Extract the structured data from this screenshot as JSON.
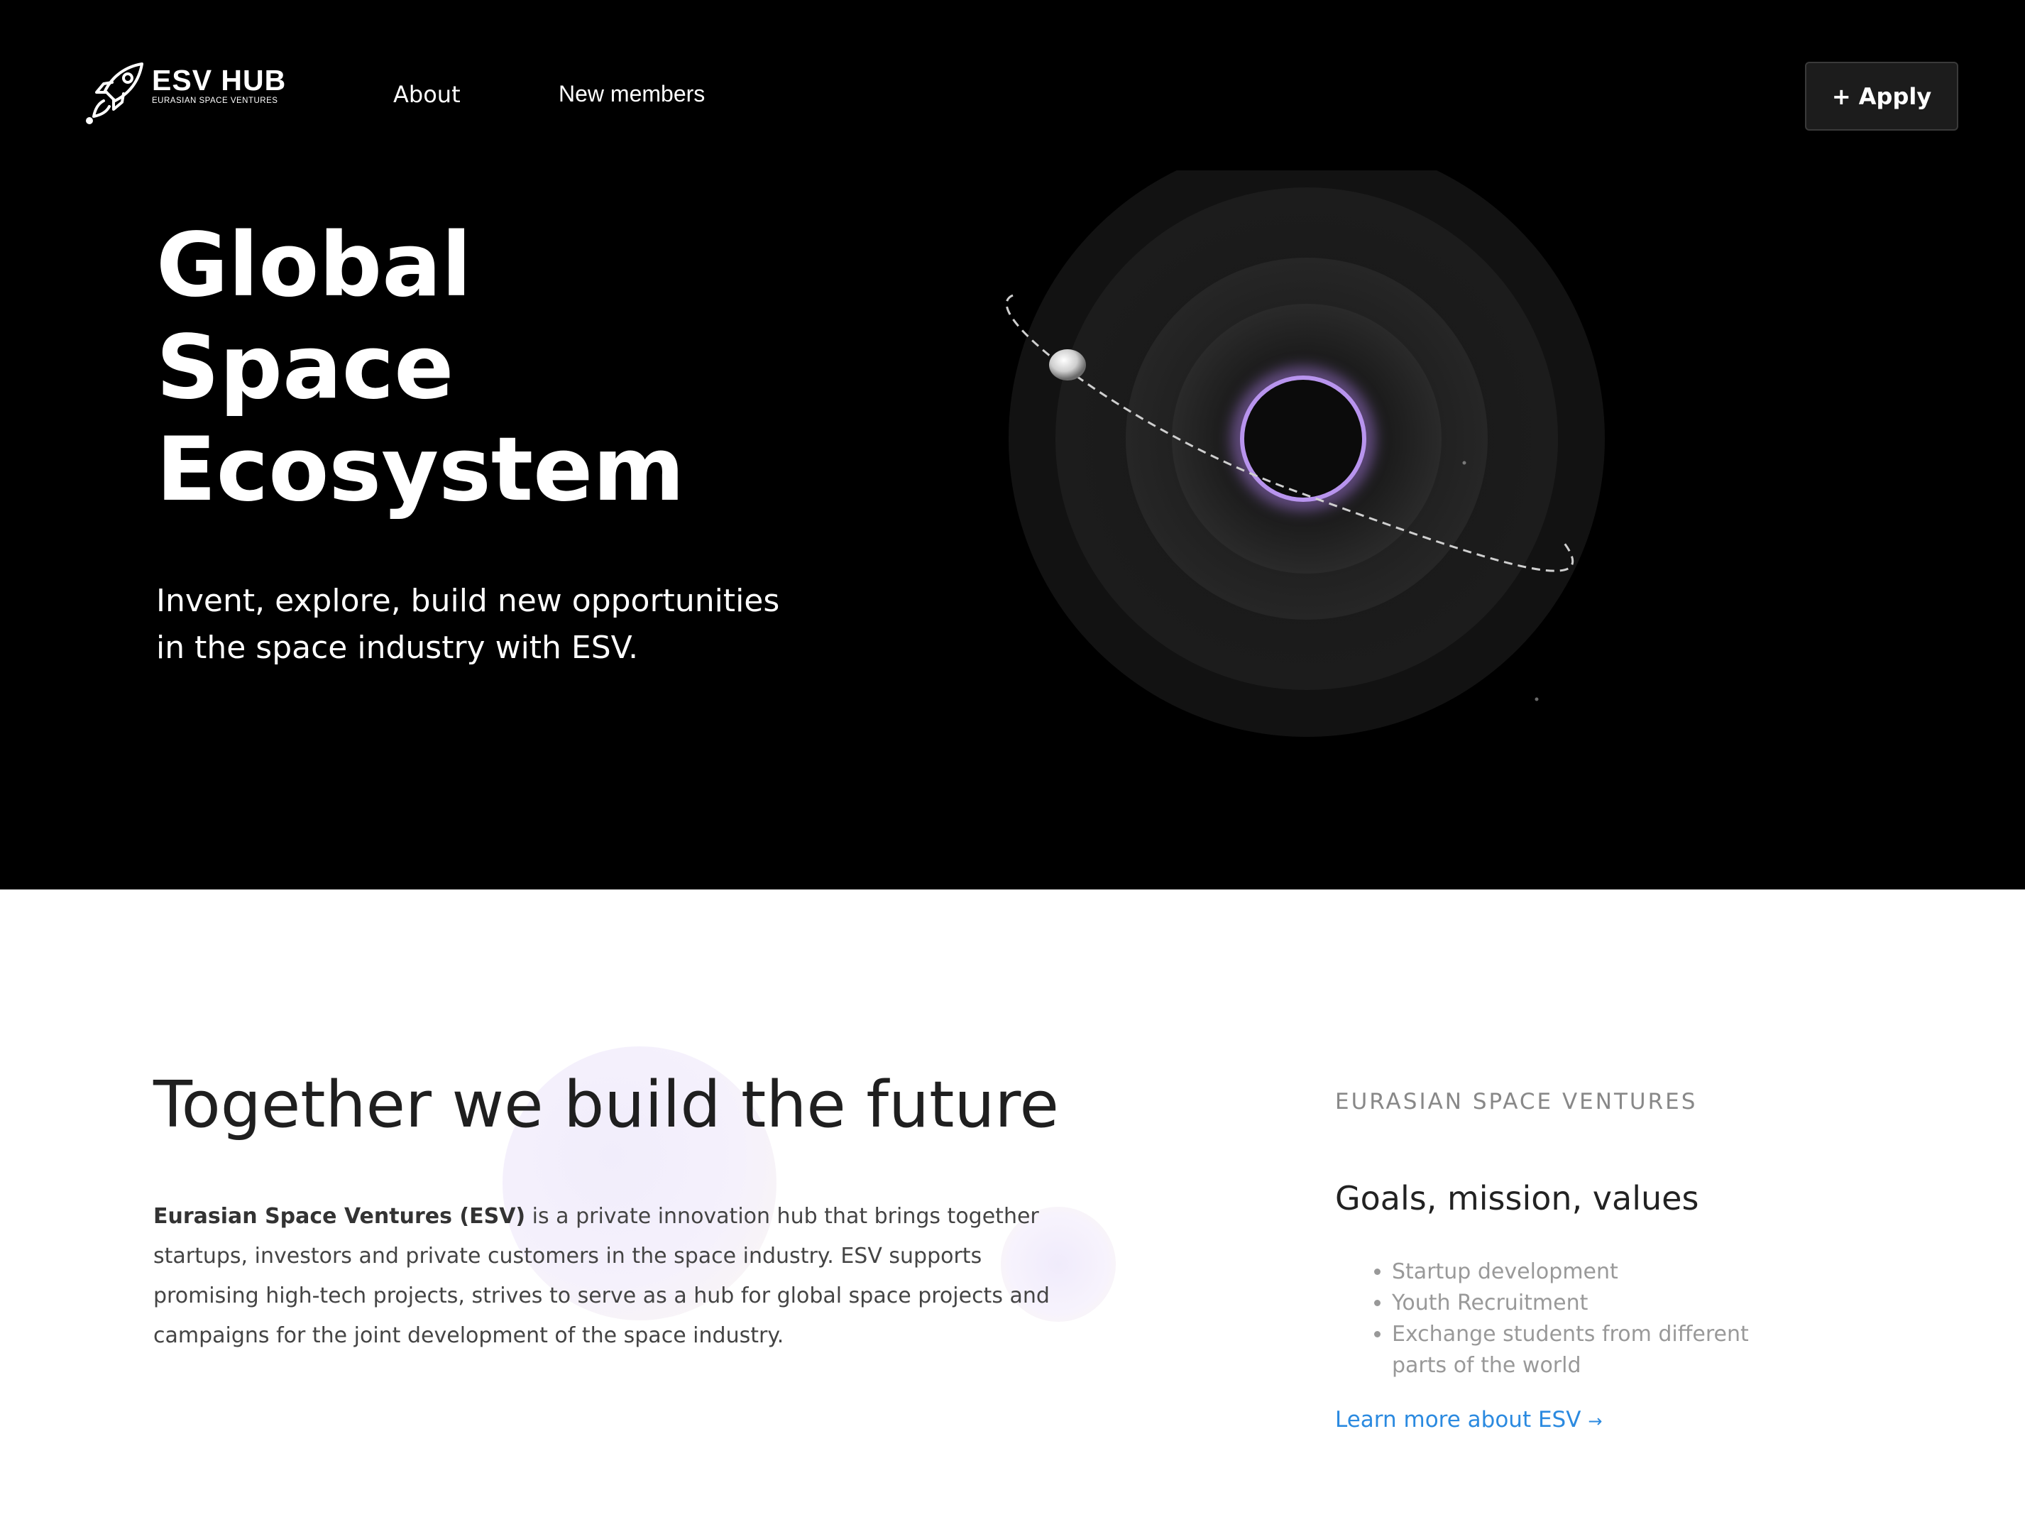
{
  "header": {
    "logo": {
      "name": "ESV HUB",
      "subtitle": "EURASIAN SPACE VENTURES",
      "icon": "rocket-icon"
    },
    "nav": [
      {
        "label": "About"
      },
      {
        "label": "New members"
      }
    ],
    "apply_label": "+ Apply"
  },
  "hero": {
    "title_lines": [
      "Global",
      "Space",
      "Ecosystem"
    ],
    "subtitle": "Invent, explore, build new opportunities in the space industry with ESV.",
    "art": {
      "glow_color": "#a77be0",
      "background": "#000000"
    }
  },
  "about": {
    "title": "Together we build the future",
    "intro_strong": "Eurasian Space Ventures (ESV)",
    "intro_text": " is a private innovation hub that brings together startups, investors and private customers in the space industry. ESV supports promising high-tech projects, strives to serve as a hub for global space projects and campaigns for the joint development of the space industry."
  },
  "sidebar": {
    "eyebrow": "EURASIAN SPACE VENTURES",
    "heading": "Goals, mission, values",
    "goals": [
      "Startup development",
      "Youth Recruitment",
      "Exchange students from different parts of the world"
    ],
    "learn_more": "Learn more about ESV",
    "learn_more_icon": "arrow-right-icon",
    "link_color": "#2b8ae0"
  }
}
